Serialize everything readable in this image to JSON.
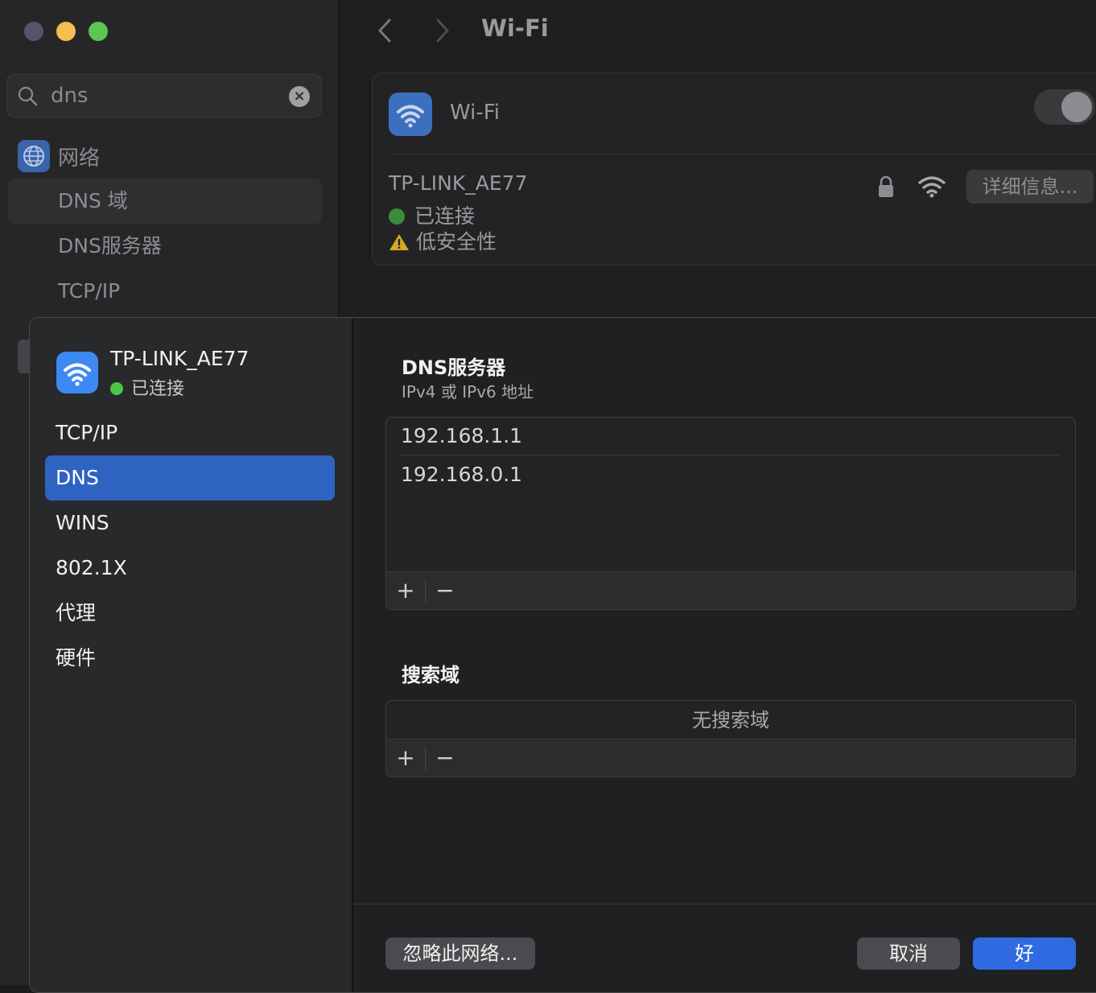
{
  "search": {
    "query": "dns"
  },
  "sidebar": {
    "section_label": "网络",
    "items": [
      {
        "label": "DNS 域"
      },
      {
        "label": "DNS服务器"
      },
      {
        "label": "TCP/IP"
      }
    ]
  },
  "main": {
    "title": "Wi-Fi",
    "wifi_toggle_label": "Wi-Fi",
    "network": {
      "name": "TP-LINK_AE77",
      "status": "已连接",
      "security": "低安全性",
      "details_button": "详细信息..."
    }
  },
  "dialog": {
    "network_name": "TP-LINK_AE77",
    "network_status": "已连接",
    "nav": [
      {
        "label": "TCP/IP"
      },
      {
        "label": "DNS"
      },
      {
        "label": "WINS"
      },
      {
        "label": "802.1X"
      },
      {
        "label": "代理"
      },
      {
        "label": "硬件"
      }
    ],
    "dns": {
      "title": "DNS服务器",
      "subtitle": "IPv4 或 IPv6 地址",
      "servers": [
        "192.168.1.1",
        "192.168.0.1"
      ],
      "add": "+",
      "remove": "−"
    },
    "search_domains": {
      "title": "搜索域",
      "empty": "无搜索域",
      "add": "+",
      "remove": "−"
    },
    "buttons": {
      "forget": "忽略此网络...",
      "cancel": "取消",
      "ok": "好"
    }
  },
  "colors": {
    "accent": "#2f63c1",
    "ok_button": "#2f6ae0",
    "connected": "#4cc544"
  }
}
